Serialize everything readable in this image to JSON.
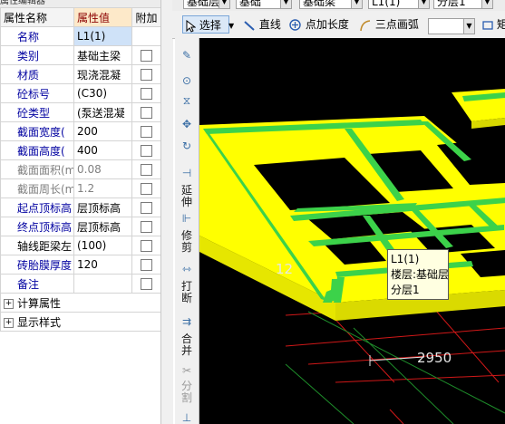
{
  "panel": {
    "header": {
      "name": "属性名称",
      "value": "属性值",
      "add": "附加"
    },
    "rows": [
      {
        "name": "名称",
        "value": "L1(1)",
        "state": "selected",
        "checkbox": false
      },
      {
        "name": "类别",
        "value": "基础主梁",
        "state": "normal",
        "checkbox": true
      },
      {
        "name": "材质",
        "value": "现浇混凝",
        "state": "normal",
        "checkbox": true
      },
      {
        "name": "砼标号",
        "value": "(C30)",
        "state": "normal",
        "checkbox": true
      },
      {
        "name": "砼类型",
        "value": "(泵送混凝",
        "state": "normal",
        "checkbox": true
      },
      {
        "name": "截面宽度(",
        "value": "200",
        "state": "normal",
        "checkbox": true
      },
      {
        "name": "截面高度(",
        "value": "400",
        "state": "normal",
        "checkbox": true
      },
      {
        "name": "截面面积(m",
        "value": "0.08",
        "state": "disabled",
        "checkbox": true
      },
      {
        "name": "截面周长(m",
        "value": "1.2",
        "state": "disabled",
        "checkbox": true
      },
      {
        "name": "起点顶标高",
        "value": "层顶标高",
        "state": "normal",
        "checkbox": true
      },
      {
        "name": "终点顶标高",
        "value": "层顶标高",
        "state": "normal",
        "checkbox": true
      },
      {
        "name": "轴线距梁左",
        "value": "(100)",
        "state": "black",
        "checkbox": true
      },
      {
        "name": "砖胎膜厚度",
        "value": "120",
        "state": "normal",
        "checkbox": true
      },
      {
        "name": "备注",
        "value": "",
        "state": "normal",
        "checkbox": true
      }
    ],
    "groups": [
      {
        "label": "计算属性",
        "expander": "+"
      },
      {
        "label": "显示样式",
        "expander": "+"
      }
    ]
  },
  "top_toolbar": {
    "floor_combo": "基础层",
    "category_combo": "基础",
    "type_combo": "基础梁",
    "element_combo": "L1(1)",
    "layer_combo": "分层1"
  },
  "draw_toolbar": {
    "select_label": "选择",
    "line_label": "直线",
    "add_length_label": "点加长度",
    "arc_label": "三点画弧",
    "extra_label": "矩"
  },
  "vertical_toolbar": {
    "extend_label": "延伸",
    "trim_label": "修剪",
    "break_label": "打断",
    "merge_label": "合并",
    "split_label": "分割"
  },
  "canvas": {
    "dimension_1": "2950",
    "dimension_2": "12",
    "tooltip": {
      "line1": "L1(1)",
      "line2": "楼层:基础层",
      "line3": "分层1"
    },
    "colors": {
      "background": "#000000",
      "beam_top": "#ffff00",
      "beam_stripe": "#3cd24a",
      "beam_side": "#e6e600",
      "axis_red": "#d01818",
      "axis_green": "#1e8c2a",
      "dimension": "#e6e6e6"
    }
  }
}
